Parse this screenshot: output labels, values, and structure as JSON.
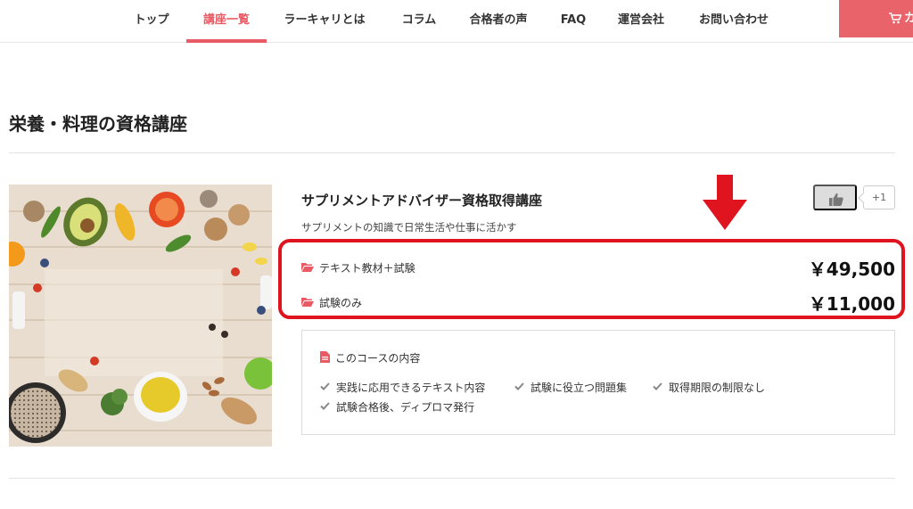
{
  "nav": {
    "items": [
      {
        "label": "トップ"
      },
      {
        "label": "講座一覧"
      },
      {
        "label": "ラーキャリとは"
      },
      {
        "label": "コラム"
      },
      {
        "label": "合格者の声"
      },
      {
        "label": "FAQ"
      },
      {
        "label": "運営会社"
      },
      {
        "label": "お問い合わせ"
      }
    ],
    "active_index": 1,
    "cart_label": "カ",
    "accent_color": "#e85a64"
  },
  "page": {
    "title": "栄養・料理の資格講座"
  },
  "course": {
    "title": "サプリメントアドバイザー資格取得講座",
    "tagline": "サプリメントの知識で日常生活や仕事に活かす",
    "like_count": "+1",
    "options": [
      {
        "label": "テキスト教材＋試験",
        "price": "￥49,500",
        "icon": "folder-open-icon"
      },
      {
        "label": "試験のみ",
        "price": "￥11,000",
        "icon": "folder-open-icon"
      }
    ],
    "contents_heading": "このコースの内容",
    "features": [
      "実践に応用できるテキスト内容",
      "試験に役立つ問題集",
      "取得期限の制限なし",
      "試験合格後、ディプロマ発行"
    ]
  },
  "annotation": {
    "color": "#e0141e"
  }
}
